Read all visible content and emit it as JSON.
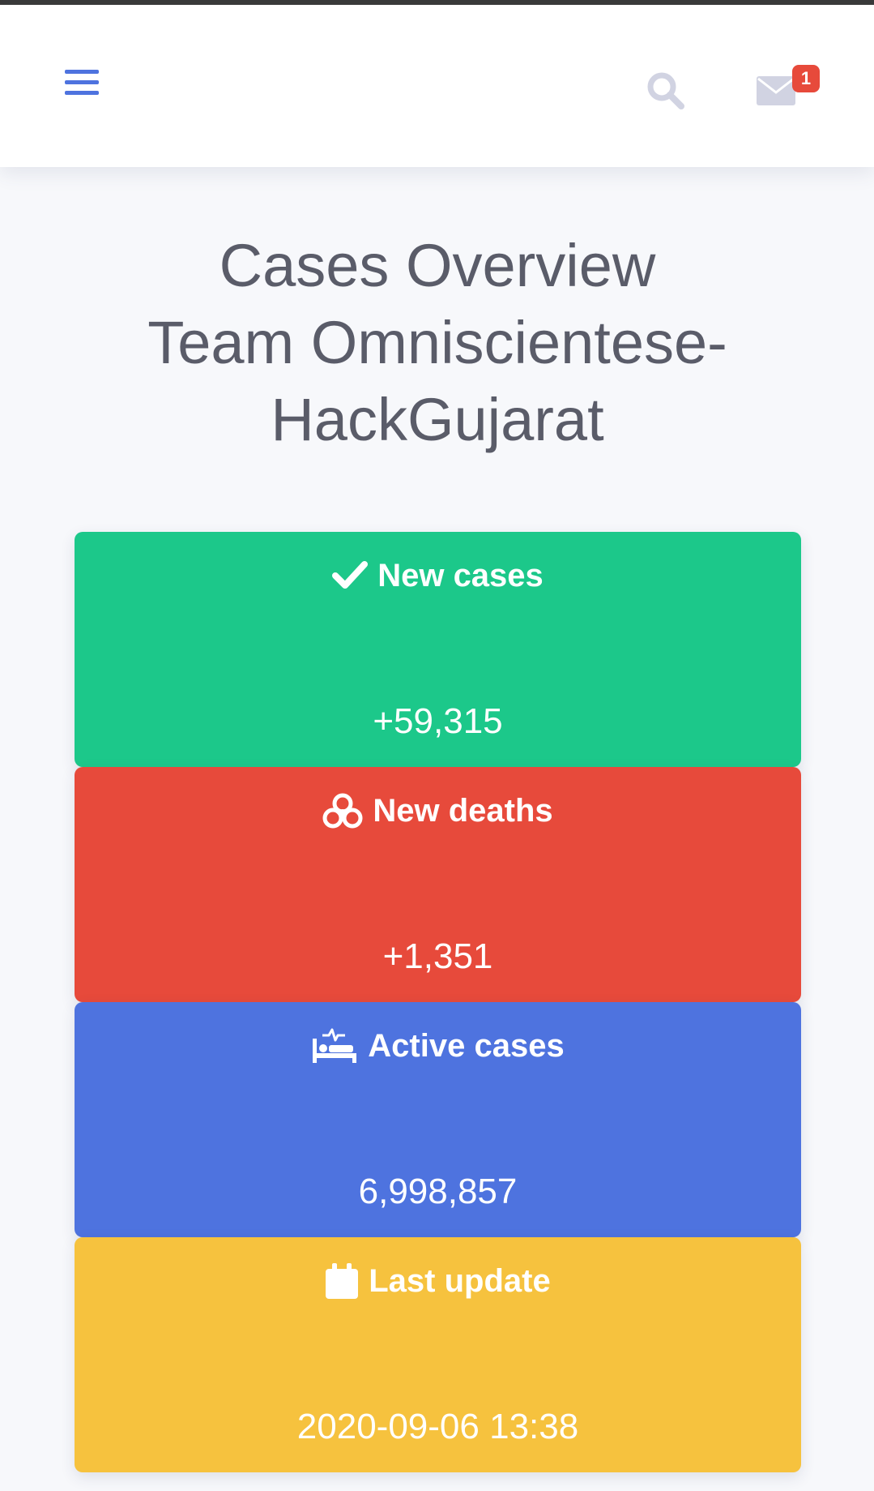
{
  "colors": {
    "accent": "#4e73df",
    "icon_muted": "#d1d3e2",
    "badge": "#e74a3b",
    "title_text": "#5a5c69",
    "card_green": "#1cc88a",
    "card_red": "#e74a3b",
    "card_blue": "#4e73df",
    "card_yellow": "#f6c23e"
  },
  "topbar": {
    "menu_icon": "hamburger-icon",
    "search_icon": "search-icon",
    "mail_icon": "envelope-icon",
    "mail_badge": "1"
  },
  "main": {
    "title": "Cases Overview\nTeam Omniscientese-\nHackGujarat"
  },
  "cards": [
    {
      "icon": "check-icon",
      "label": "New cases",
      "value": "+59,315",
      "color": "#1cc88a"
    },
    {
      "icon": "biohazard-icon",
      "label": "New deaths",
      "value": "+1,351",
      "color": "#e74a3b"
    },
    {
      "icon": "procedures-bed-icon",
      "label": "Active cases",
      "value": "6,998,857",
      "color": "#4e73df"
    },
    {
      "icon": "calendar-icon",
      "label": "Last update",
      "value": "2020-09-06 13:38",
      "color": "#f6c23e"
    }
  ]
}
